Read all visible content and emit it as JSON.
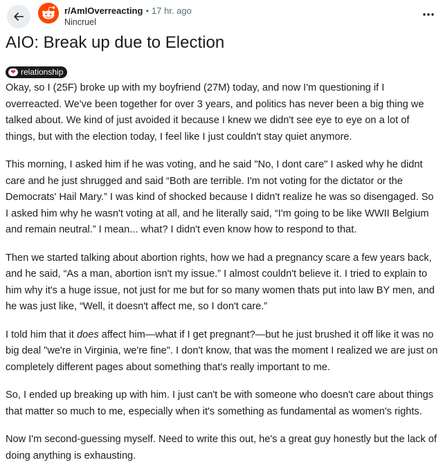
{
  "header": {
    "subreddit": "r/AmIOverreacting",
    "separator": "•",
    "age": "17 hr. ago",
    "author": "Nincruel"
  },
  "post": {
    "title": "AIO: Break up due to Election",
    "flair": "relationship",
    "paragraphs": [
      "Okay, so I (25F) broke up with my boyfriend (27M) today, and now I'm questioning if I overreacted. We've been together for over 3 years, and politics has never been a big thing we talked about. We kind of just avoided it because I knew we didn't see eye to eye on a lot of things, but with the election today, I feel like I just couldn't stay quiet anymore.",
      "This morning, I asked him if he was voting, and he said \"No, I dont care\" I asked why he didnt care and he just shrugged and said “Both are terrible. I'm not voting for the dictator or the Democrats' Hail Mary.” I was kind of shocked because I didn't realize he was so disengaged. So I asked him why he wasn't voting at all, and he literally said, “I'm going to be like WWII Belgium and remain neutral.” I mean... what? I didn't even know how to respond to that.",
      "Then we started talking about abortion rights, how we had a pregnancy scare a few years back, and he said, “As a man, abortion isn't my issue.” I almost couldn't believe it. I tried to explain to him why it's a huge issue, not just for me but for so many women thats put into law BY men, and he was just like, “Well, it doesn't affect me, so I don't care.”",
      "So, I ended up breaking up with him. I just can't be with someone who doesn't care about things that matter so much to me, especially when it's something as fundamental as women's rights.",
      "Now I'm second-guessing myself. Need to write this out, he's a great guy honestly but the lack of doing anything is exhausting."
    ],
    "p4": {
      "before": "I told him that it ",
      "emphasis": "does",
      "after": " affect him—what if I get pregnant?—but he just brushed it off like it was no big deal \"we're in Virginia, we're fine\". I don't know, that was the moment I realized we are just on completely different pages about something that's really important to me."
    }
  },
  "icons": {
    "back": "arrow-left-icon",
    "avatar": "reddit-snoo-icon",
    "more": "more-horizontal-icon",
    "flair": "heart-icon"
  },
  "colors": {
    "flair_bg": "#1a1a1b",
    "avatar_bg": "#ff4500",
    "back_bg": "#eaedef"
  }
}
